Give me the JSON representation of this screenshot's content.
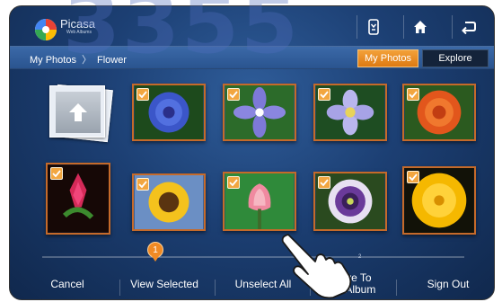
{
  "watermark": "3355",
  "app": {
    "logo_text": "Picasa",
    "logo_sub": "Web Albums"
  },
  "top_icons": [
    "remote-icon",
    "home-icon",
    "return-icon"
  ],
  "breadcrumb": {
    "root": "My Photos",
    "separator": "〉",
    "current": "Flower"
  },
  "tabs": {
    "my_photos": "My Photos",
    "explore": "Explore"
  },
  "grid": {
    "rows": [
      [
        {
          "name": "photo-blue-cornflower",
          "checked": true
        },
        {
          "name": "photo-periwinkle",
          "checked": true
        },
        {
          "name": "photo-blue-anemone",
          "checked": true
        },
        {
          "name": "photo-orange-zinnia",
          "checked": true
        }
      ],
      [
        {
          "name": "photo-red-ginger",
          "checked": true
        },
        {
          "name": "photo-sunflower",
          "checked": true
        },
        {
          "name": "photo-pink-tulip",
          "checked": true
        },
        {
          "name": "photo-passion-flower",
          "checked": true
        },
        {
          "name": "photo-yellow-poppy",
          "checked": true
        }
      ]
    ]
  },
  "selection_count": "1",
  "small_count": "2",
  "bottom": {
    "cancel": "Cancel",
    "view_selected": "View Selected",
    "unselect_all": "Unselect All",
    "save_line1": "Save To",
    "save_line2": "My Album",
    "sign_out": "Sign Out"
  },
  "colors": {
    "accent": "#f08a24",
    "tile_border": "#c56a2a",
    "screen_bg": "#1c3f73"
  }
}
